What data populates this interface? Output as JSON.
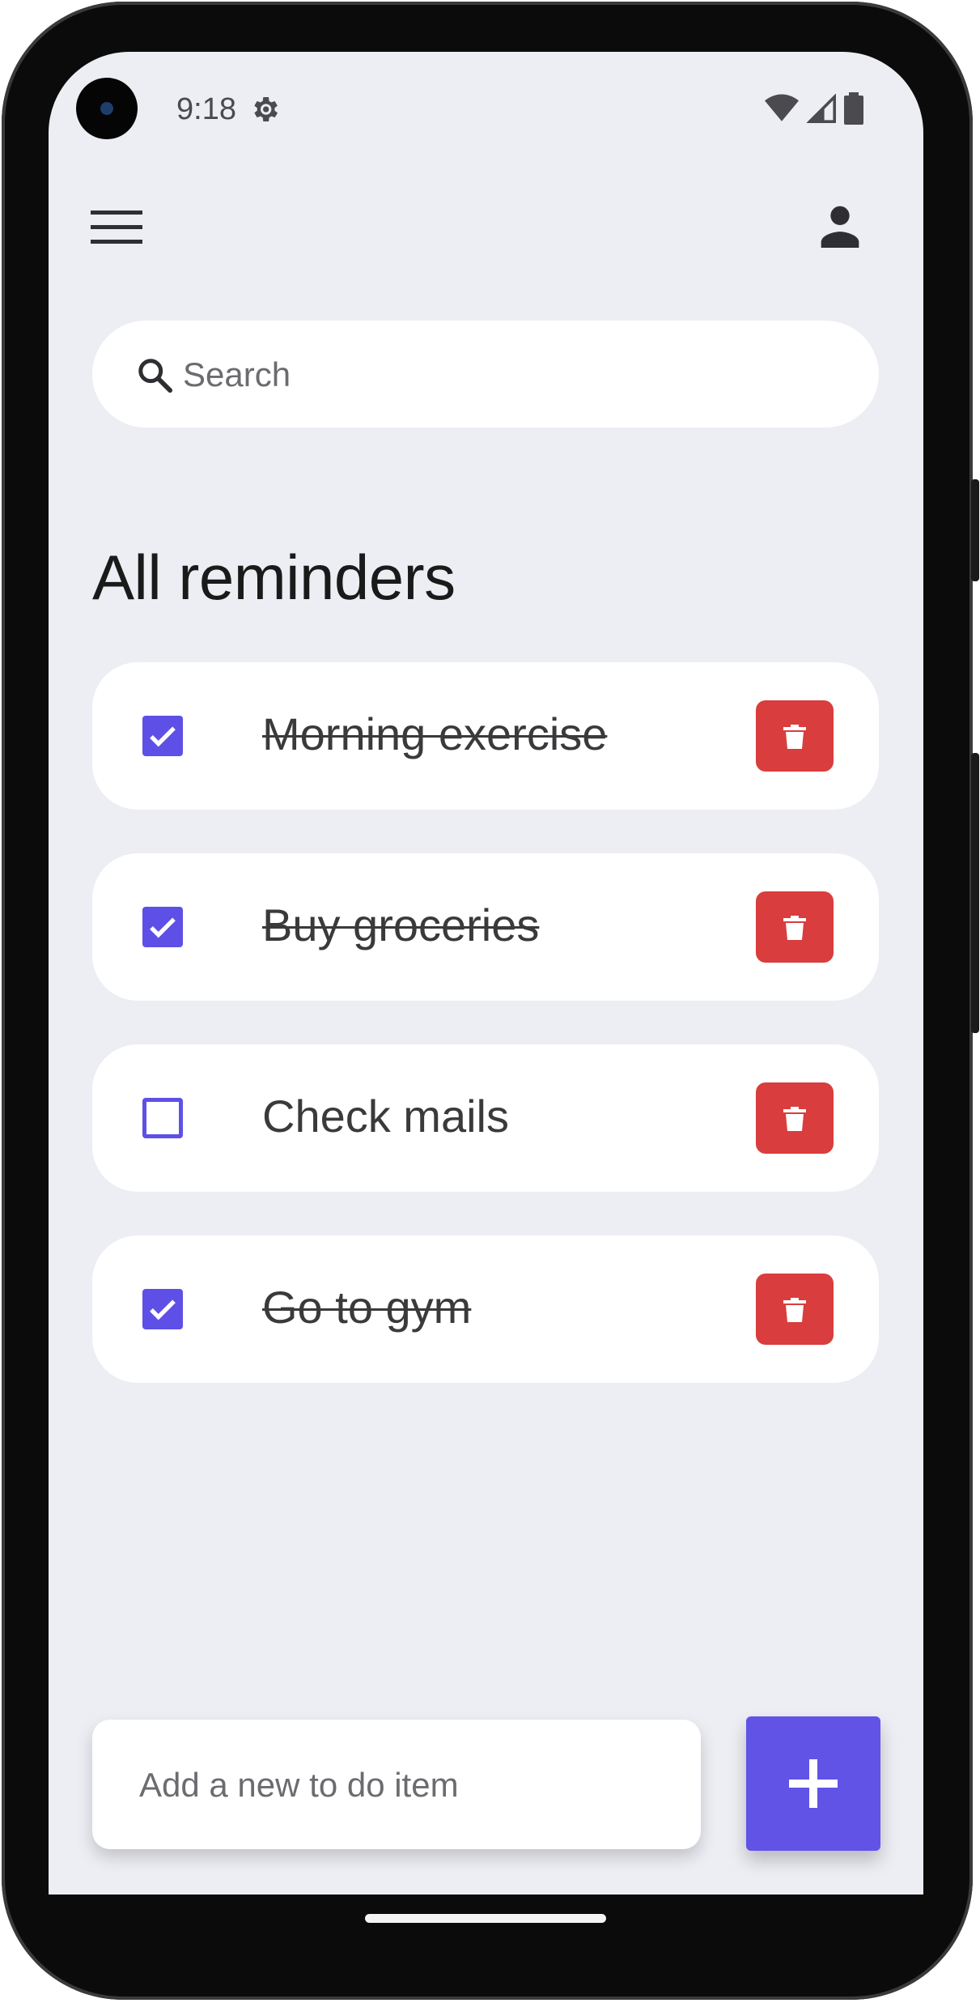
{
  "status_bar": {
    "time": "9:18",
    "icons": [
      "settings-gear-icon",
      "wifi-icon",
      "cellular-signal-icon",
      "battery-icon"
    ]
  },
  "app_bar": {
    "menu_icon": "menu-icon",
    "account_icon": "account-icon"
  },
  "search": {
    "placeholder": "Search",
    "icon": "search-icon"
  },
  "page_title": "All reminders",
  "todos": [
    {
      "text": "Morning exercise",
      "done": true
    },
    {
      "text": "Buy groceries",
      "done": true
    },
    {
      "text": "Check mails",
      "done": false
    },
    {
      "text": "Go to gym",
      "done": true
    }
  ],
  "add_item": {
    "placeholder": "Add a new to do item",
    "button_icon": "plus-icon"
  },
  "colors": {
    "accent": "#5e50e6",
    "delete": "#d93d3d",
    "background": "#eceef4",
    "card": "#ffffff"
  }
}
